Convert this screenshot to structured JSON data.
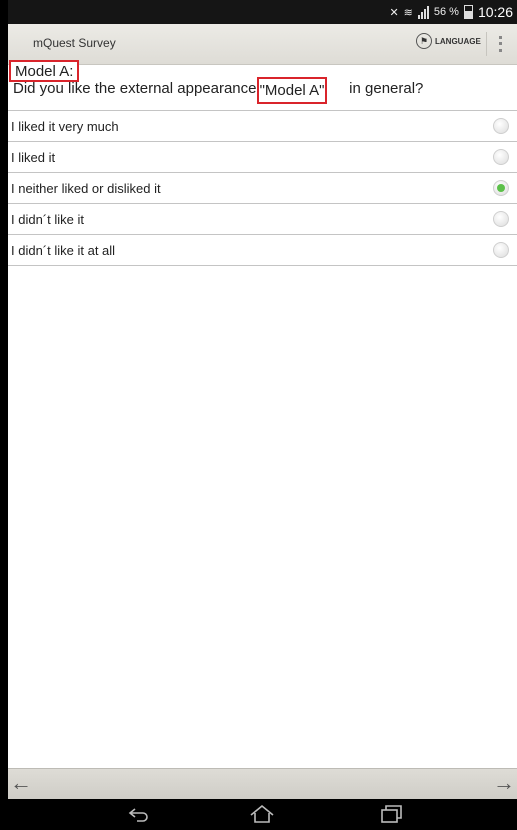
{
  "status_bar": {
    "battery": "56 %",
    "time": "10:26"
  },
  "action_bar": {
    "title": "mQuest Survey",
    "language_label": "LANGUAGE",
    "language_icon": "flag-icon"
  },
  "question": {
    "model_label": "Model A:",
    "text_before": "Did you like the external appearance of",
    "model_name": "\"Model A\"",
    "text_after": "in general?"
  },
  "options": [
    {
      "label": "I liked it very much",
      "selected": false
    },
    {
      "label": "I liked it",
      "selected": false
    },
    {
      "label": "I neither liked or disliked it",
      "selected": true
    },
    {
      "label": "I didn´t like it",
      "selected": false
    },
    {
      "label": "I didn´t like it at all",
      "selected": false
    }
  ],
  "colors": {
    "highlight": "#d9242b",
    "radio_selected": "#5cc04a"
  },
  "navigation": {
    "back_icon": "arrow-left-icon",
    "next_icon": "arrow-right-icon"
  }
}
